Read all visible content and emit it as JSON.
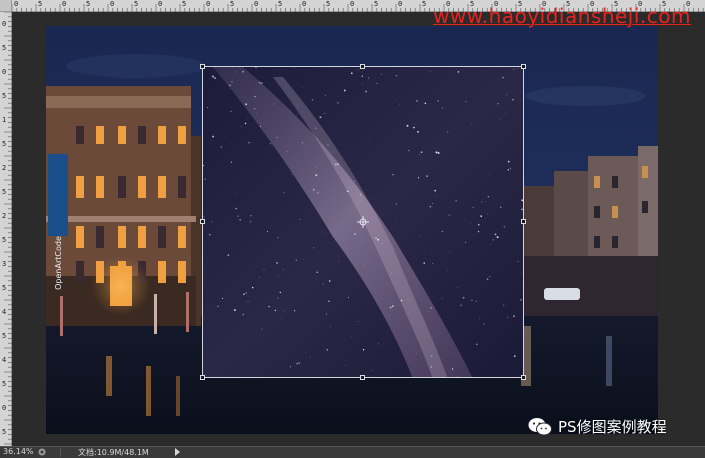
{
  "watermark": {
    "url": "www.haoyidiansheji.com"
  },
  "rulers": {
    "top_labels": [
      "0",
      "5",
      "0",
      "5",
      "0",
      "5",
      "0",
      "5",
      "0",
      "5",
      "0",
      "5",
      "0",
      "5",
      "0",
      "5",
      "0",
      "5",
      "0",
      "5",
      "0",
      "5",
      "0",
      "5",
      "0",
      "5",
      "0",
      "5",
      "0"
    ],
    "left_labels": [
      "0",
      "5",
      "0",
      "5",
      "1",
      "5",
      "2",
      "5",
      "2",
      "5",
      "3",
      "5",
      "4",
      "5",
      "4",
      "5",
      "0",
      "5"
    ]
  },
  "document": {
    "sign_text": "OpenArtCode"
  },
  "brand": {
    "icon": "wechat-icon",
    "label": "PS修图案例教程"
  },
  "statusbar": {
    "zoom": "36.14%",
    "doc_info": "文档:10.9M/48.1M"
  },
  "colors": {
    "accent_watermark": "#e8231e",
    "sky": "#1d2c58",
    "window_light": "#f5a43a",
    "transform_border": "#cfd6e0"
  }
}
